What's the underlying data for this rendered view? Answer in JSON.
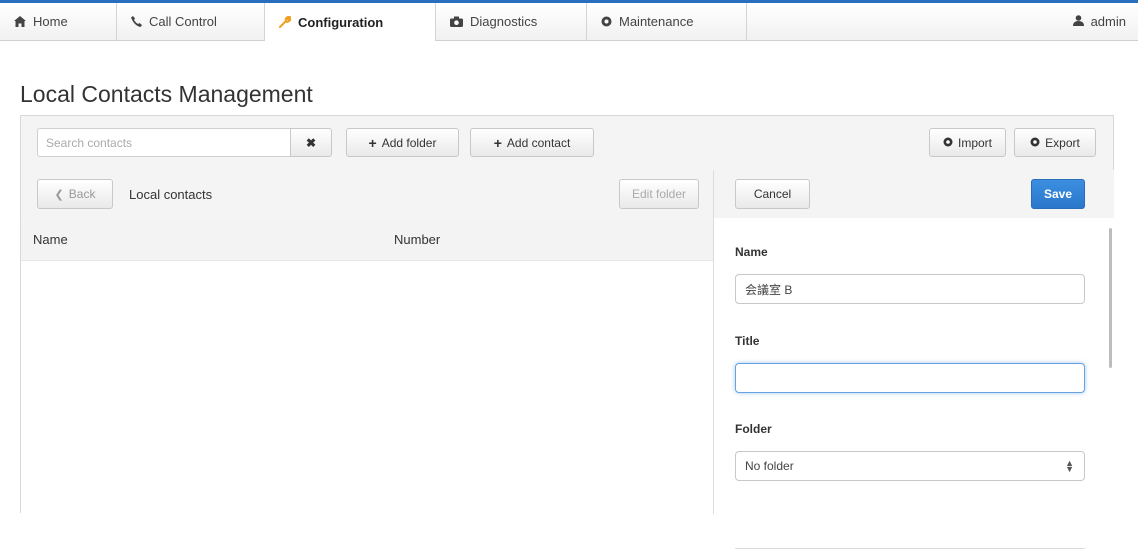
{
  "nav": {
    "tabs": [
      {
        "label": "Home",
        "icon": "home-icon"
      },
      {
        "label": "Call Control",
        "icon": "phone-icon"
      },
      {
        "label": "Configuration",
        "icon": "wrench-icon",
        "active": true
      },
      {
        "label": "Diagnostics",
        "icon": "camera-icon"
      },
      {
        "label": "Maintenance",
        "icon": "gear-icon"
      }
    ],
    "user": "admin"
  },
  "page": {
    "title": "Local Contacts Management"
  },
  "toolbar": {
    "search_placeholder": "Search contacts",
    "clear_label": "✖",
    "add_folder_label": "Add folder",
    "add_contact_label": "Add contact",
    "import_label": "Import",
    "export_label": "Export"
  },
  "list": {
    "back_label": "Back",
    "title": "Local contacts",
    "edit_folder_label": "Edit folder",
    "columns": [
      "Name",
      "Number"
    ]
  },
  "form": {
    "cancel_label": "Cancel",
    "save_label": "Save",
    "name_label": "Name",
    "name_value": "会議室 B",
    "title_label": "Title",
    "title_value": "",
    "folder_label": "Folder",
    "folder_value": "No folder"
  },
  "colors": {
    "accent": "#2a77cc",
    "top_line": "#2a6fbf"
  }
}
